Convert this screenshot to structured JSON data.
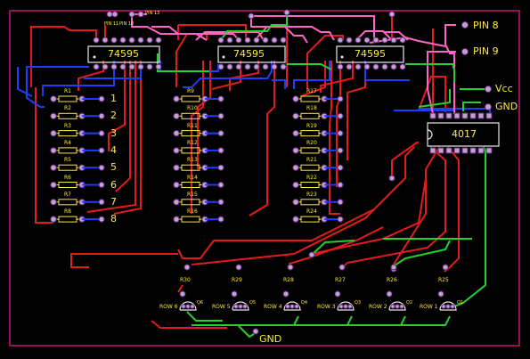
{
  "chips": {
    "sr1": "74595",
    "sr2": "74595",
    "sr3": "74595",
    "counter": "4017"
  },
  "pins": {
    "pin8": "PIN 8",
    "pin9": "PIN 9",
    "vcc": "Vcc",
    "gnd_right": "GND",
    "gnd_bottom": "GND",
    "pin11": "PIN 11",
    "pin10": "PIN 10",
    "pin13": "PIN 13"
  },
  "resistors_left": [
    "R1",
    "R2",
    "R3",
    "R4",
    "R5",
    "R6",
    "R7",
    "R8"
  ],
  "resistors_mid": [
    "R9",
    "R10",
    "R11",
    "R12",
    "R13",
    "R14",
    "R15",
    "R16"
  ],
  "resistors_right": [
    "R17",
    "R18",
    "R19",
    "R20",
    "R21",
    "R22",
    "R23",
    "R24"
  ],
  "column_numbers": [
    "1",
    "2",
    "3",
    "4",
    "5",
    "6",
    "7",
    "8"
  ],
  "base_resistors": [
    "R30",
    "R29",
    "R28",
    "R27",
    "R26",
    "R25"
  ],
  "transistor_labels": [
    "Q6",
    "Q5",
    "Q4",
    "Q3",
    "Q2",
    "Q1"
  ],
  "rows": [
    "ROW 6",
    "ROW 5",
    "ROW 4",
    "ROW 3",
    "ROW 2",
    "ROW 1"
  ],
  "colors": {
    "border": "#c8147a",
    "pad": "#c8a0d0",
    "silk": "#ffea3a",
    "red": "#e41b1b",
    "blue": "#1f3dff",
    "green": "#22d22e",
    "pink": "#ff66c4"
  }
}
